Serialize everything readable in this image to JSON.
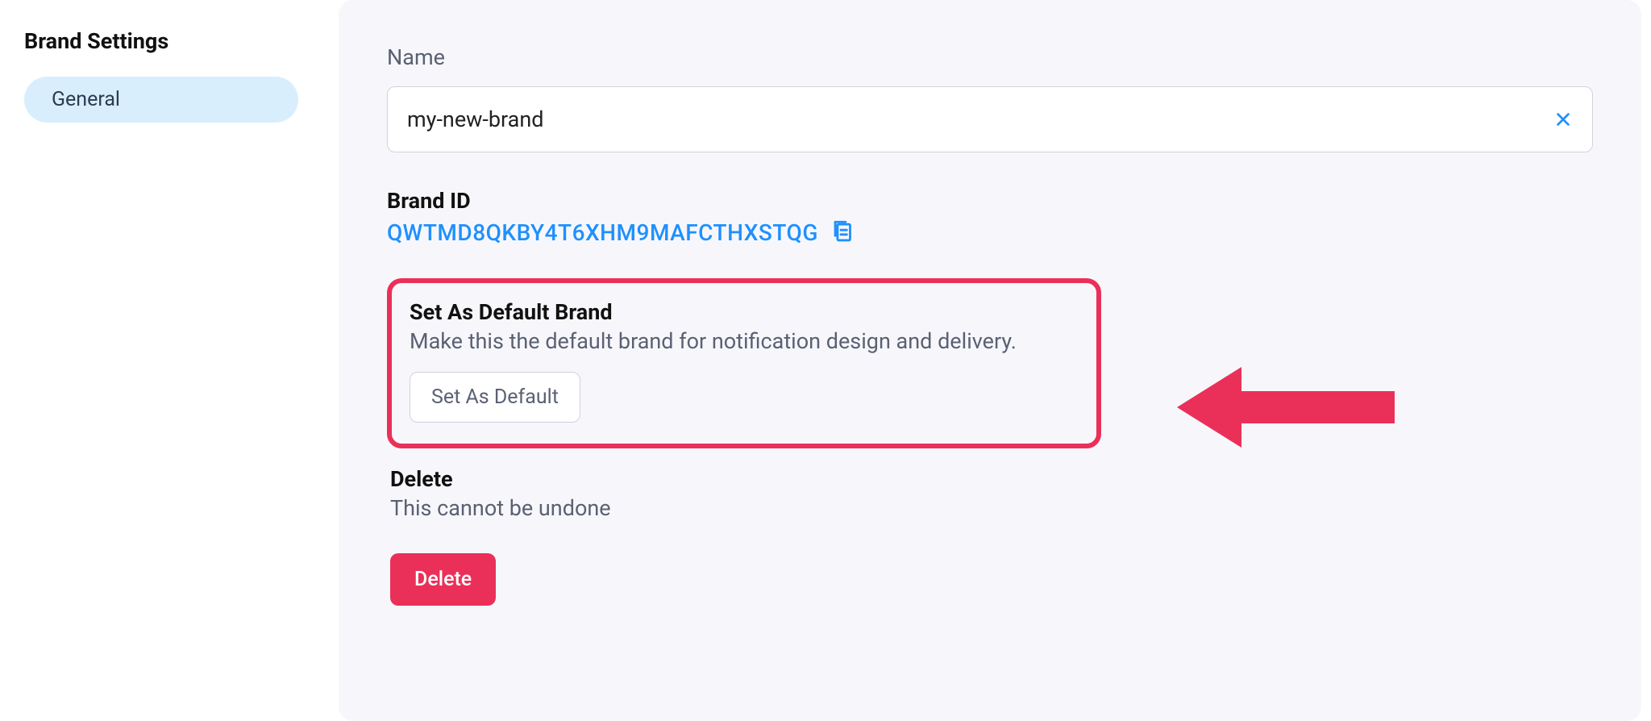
{
  "sidebar": {
    "title": "Brand Settings",
    "items": [
      {
        "label": "General",
        "active": true
      }
    ]
  },
  "main": {
    "name_label": "Name",
    "name_value": "my-new-brand",
    "brand_id_label": "Brand ID",
    "brand_id_value": "QWTMD8QKBY4T6XHM9MAFCTHXSTQG",
    "default_section": {
      "title": "Set As Default Brand",
      "desc": "Make this the default brand for notification design and delivery.",
      "button": "Set As Default"
    },
    "delete_section": {
      "title": "Delete",
      "desc": "This cannot be undone",
      "button": "Delete"
    }
  },
  "colors": {
    "accent": "#1e90ff",
    "danger": "#ea3059",
    "muted": "#5a6173"
  }
}
